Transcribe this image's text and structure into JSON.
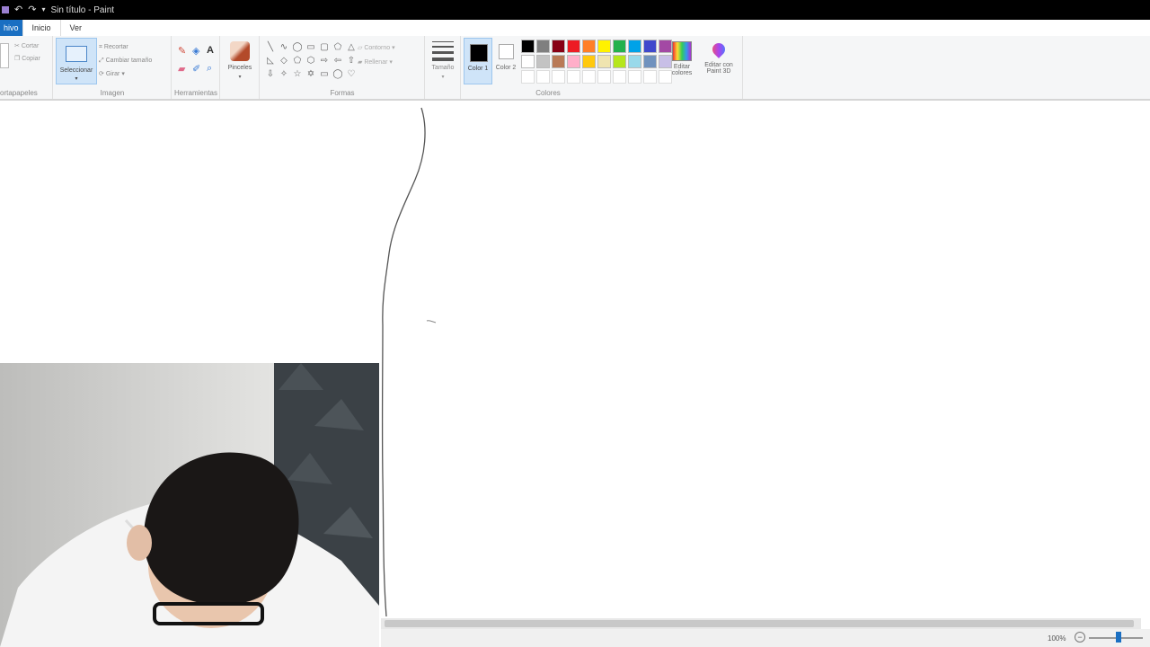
{
  "window": {
    "title": "Sin título - Paint"
  },
  "tabs": [
    {
      "label": "hivo"
    },
    {
      "label": "Inicio"
    },
    {
      "label": "Ver"
    }
  ],
  "ribbon": {
    "clipboard": {
      "label": "ortapapeles",
      "cut": "Cortar",
      "copy": "Copiar"
    },
    "image": {
      "label": "Imagen",
      "select": "Seleccionar",
      "crop": "Recortar",
      "resize": "Cambiar tamaño",
      "rotate": "Girar"
    },
    "tools": {
      "label": "Herramientas"
    },
    "brushes": {
      "label": "Pinceles"
    },
    "shapes": {
      "label": "Formas",
      "outline": "Contorno",
      "fill": "Rellenar"
    },
    "size": {
      "label": "Tamaño"
    },
    "colors": {
      "label": "Colores",
      "color1": "Color 1",
      "color2": "Color 2",
      "edit": "Editar colores",
      "paint3d": "Editar con Paint 3D",
      "palette_row1": [
        "#000000",
        "#7f7f7f",
        "#880015",
        "#ed1c24",
        "#ff7f27",
        "#fff200",
        "#22b14c",
        "#00a2e8",
        "#3f48cc",
        "#a349a4"
      ],
      "palette_row2": [
        "#ffffff",
        "#c3c3c3",
        "#b97a57",
        "#ffaec9",
        "#ffc90e",
        "#efe4b0",
        "#b5e61d",
        "#99d9ea",
        "#7092be",
        "#c8bfe7"
      ],
      "palette_row3": [
        "#ffffff",
        "#ffffff",
        "#ffffff",
        "#ffffff",
        "#ffffff",
        "#ffffff",
        "#ffffff",
        "#ffffff",
        "#ffffff",
        "#ffffff"
      ]
    }
  },
  "status": {
    "zoom": "100%"
  },
  "colors": {
    "accent": "#1a6fc2",
    "ribbon_bg": "#f5f6f7",
    "titlebar": "#000000"
  }
}
